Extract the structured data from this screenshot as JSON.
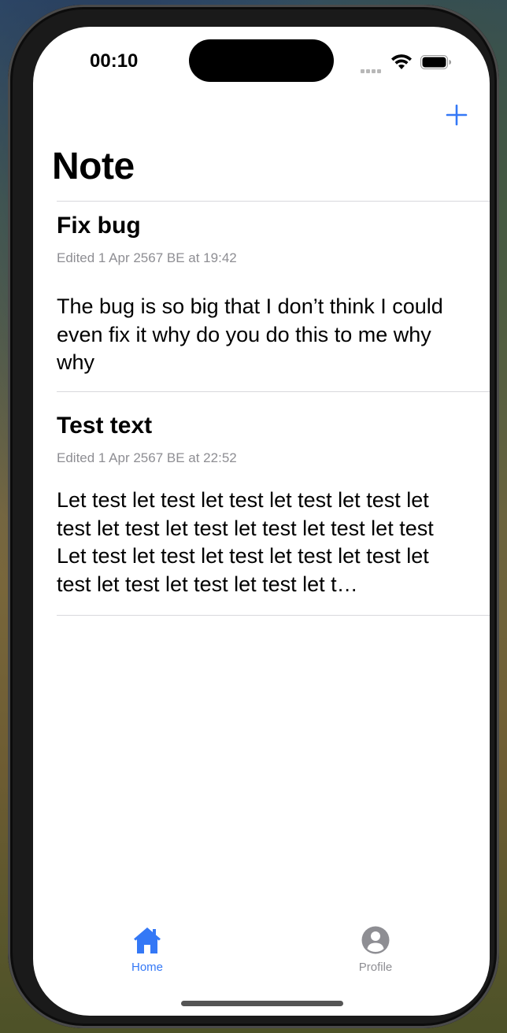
{
  "status_bar": {
    "time": "00:10"
  },
  "header": {
    "title": "Note",
    "add_icon": "plus-icon"
  },
  "notes": [
    {
      "title": "Fix bug",
      "edited": "Edited 1 Apr 2567 BE at 19:42",
      "body": "The bug is so big that I don’t think I could even fix it why do you do this to me why why"
    },
    {
      "title": "Test text",
      "edited": "Edited 1 Apr 2567 BE at 22:52",
      "body": "Let test let test let test let test let test let test let test let test let test let test let test Let test let test let test let test let test let test let test let test let test let t…"
    }
  ],
  "tab_bar": {
    "items": [
      {
        "label": "Home",
        "icon": "house-icon",
        "selected": true
      },
      {
        "label": "Profile",
        "icon": "person-circle-icon",
        "selected": false
      }
    ]
  },
  "colors": {
    "accent": "#3478f6",
    "secondary_text": "#8e8e93",
    "divider": "#d8d8dc"
  }
}
